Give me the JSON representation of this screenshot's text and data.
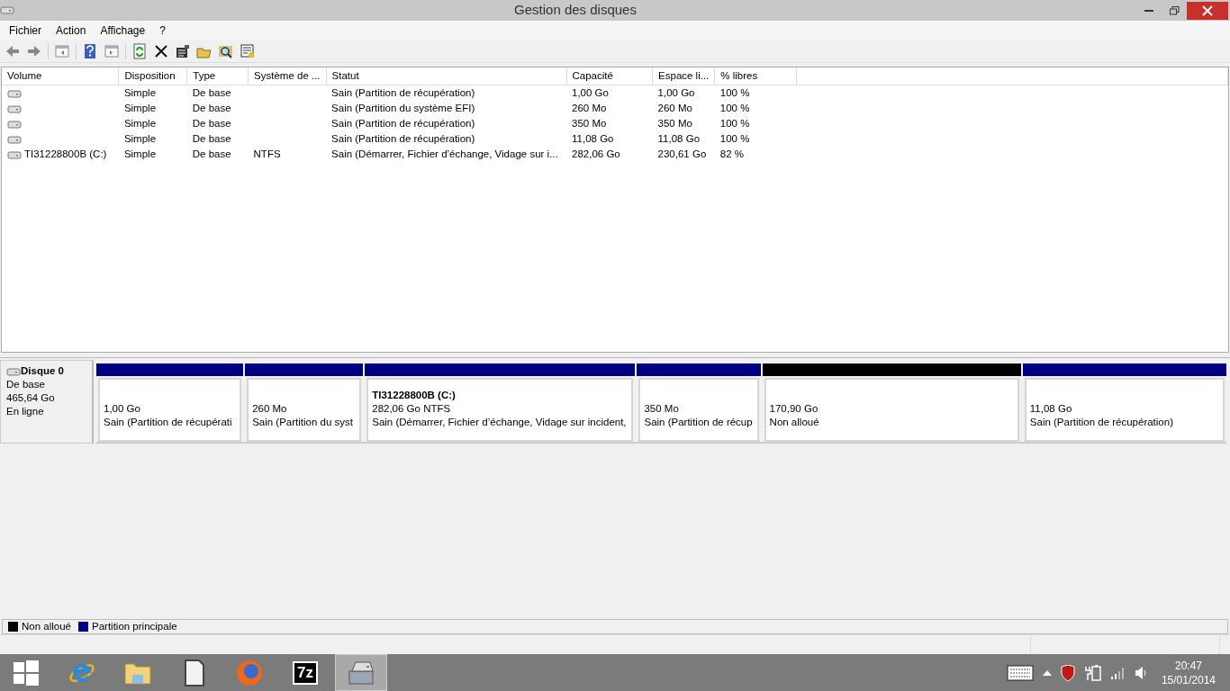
{
  "window": {
    "title": "Gestion des disques"
  },
  "menu": [
    "Fichier",
    "Action",
    "Affichage",
    "?"
  ],
  "table": {
    "columns": [
      "Volume",
      "Disposition",
      "Type",
      "Système de ...",
      "Statut",
      "Capacité",
      "Espace li...",
      "% libres"
    ],
    "rows": [
      {
        "cells": [
          "",
          "Simple",
          "De base",
          "",
          "Sain (Partition de récupération)",
          "1,00 Go",
          "1,00 Go",
          "100 %"
        ]
      },
      {
        "cells": [
          "",
          "Simple",
          "De base",
          "",
          "Sain (Partition du système EFI)",
          "260 Mo",
          "260 Mo",
          "100 %"
        ]
      },
      {
        "cells": [
          "",
          "Simple",
          "De base",
          "",
          "Sain (Partition de récupération)",
          "350 Mo",
          "350 Mo",
          "100 %"
        ]
      },
      {
        "cells": [
          "",
          "Simple",
          "De base",
          "",
          "Sain (Partition de récupération)",
          "11,08 Go",
          "11,08 Go",
          "100 %"
        ]
      },
      {
        "cells": [
          "TI31228800B (C:)",
          "Simple",
          "De base",
          "NTFS",
          "Sain (Démarrer, Fichier d’échange, Vidage sur i...",
          "282,06 Go",
          "230,61 Go",
          "82 %"
        ]
      }
    ]
  },
  "disk": {
    "name": "Disque 0",
    "type": "De base",
    "size": "465,64 Go",
    "status": "En ligne",
    "partitions": [
      {
        "kind": "primary",
        "size": "1,00 Go",
        "status": "Sain (Partition de récupérati"
      },
      {
        "kind": "primary",
        "size": "260 Mo",
        "status": "Sain (Partition du syst"
      },
      {
        "kind": "primary",
        "label": "TI31228800B  (C:)",
        "size": "282,06 Go NTFS",
        "status": "Sain (Démarrer, Fichier d’échange, Vidage sur incident,"
      },
      {
        "kind": "primary",
        "size": "350 Mo",
        "status": "Sain (Partition de récup"
      },
      {
        "kind": "unallocated",
        "size": "170,90 Go",
        "status": "Non alloué"
      },
      {
        "kind": "primary",
        "size": "11,08 Go",
        "status": "Sain (Partition de récupération)"
      }
    ]
  },
  "legend": [
    {
      "label": "Non alloué",
      "color": "#000000"
    },
    {
      "label": "Partition principale",
      "color": "#000080"
    }
  ],
  "taskbar": {
    "items": [
      {
        "kind": "start",
        "selected": false
      },
      {
        "kind": "browser",
        "selected": false
      },
      {
        "kind": "folder",
        "selected": false
      },
      {
        "kind": "document",
        "selected": false
      },
      {
        "kind": "globe",
        "selected": false
      },
      {
        "kind": "archiver",
        "label": "7z",
        "selected": false
      },
      {
        "kind": "disk",
        "selected": true
      }
    ],
    "time": "20:47",
    "date": "15/01/2014"
  }
}
